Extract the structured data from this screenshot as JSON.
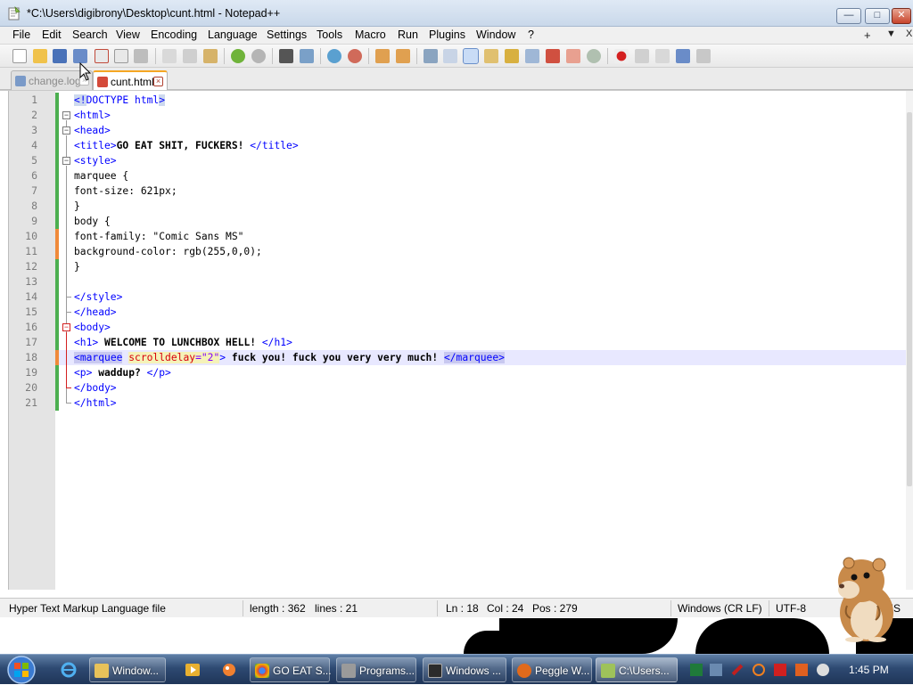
{
  "window": {
    "title": "*C:\\Users\\digibrony\\Desktop\\cunt.html - Notepad++",
    "min_glyph": "—",
    "max_glyph": "□",
    "close_glyph": "✕"
  },
  "menu": {
    "items": [
      "File",
      "Edit",
      "Search",
      "View",
      "Encoding",
      "Language",
      "Settings",
      "Tools",
      "Macro",
      "Run",
      "Plugins",
      "Window",
      "?"
    ],
    "right_plus": "+",
    "right_down": "▼",
    "right_close": "X"
  },
  "toolbar": {
    "icons": [
      "new-file",
      "open-file",
      "save",
      "save-all",
      "close",
      "close-all",
      "print",
      "cut",
      "copy",
      "paste",
      "undo",
      "redo",
      "find",
      "replace",
      "zoom-in",
      "zoom-out",
      "sync-vertical",
      "sync-horizontal",
      "word-wrap",
      "show-all-chars",
      "indent-guide",
      "user-defined-language",
      "doc-map",
      "function-list",
      "folder-as-workspace",
      "monitor",
      "record-macro",
      "stop-recording",
      "playback-macro",
      "run-macro-multiple",
      "save-macro"
    ]
  },
  "tabs": [
    {
      "label": "change.log",
      "active": false
    },
    {
      "label": "cunt.html",
      "active": true
    }
  ],
  "editor": {
    "line_numbers": [
      "1",
      "2",
      "3",
      "4",
      "5",
      "6",
      "7",
      "8",
      "9",
      "10",
      "11",
      "12",
      "13",
      "14",
      "15",
      "16",
      "17",
      "18",
      "19",
      "20",
      "21"
    ],
    "current_line": 18,
    "lines": {
      "l1": {
        "open": "<!",
        "rest": "DOCTYPE html",
        "close": ">"
      },
      "l2": {
        "tag": "<html>"
      },
      "l3": {
        "tag": "<head>"
      },
      "l4": {
        "open": "<title>",
        "text": "GO EAT SHIT, FUCKERS! ",
        "close": "</title>"
      },
      "l5": {
        "tag": "<style>"
      },
      "l6": {
        "text": "marquee {"
      },
      "l7": {
        "text": "font-size: 621px;"
      },
      "l8": {
        "text": "}"
      },
      "l9": {
        "text": "body {"
      },
      "l10": {
        "text": "font-family: \"Comic Sans MS\""
      },
      "l11": {
        "text": "background-color: rgb(255,0,0);"
      },
      "l12": {
        "text": "}"
      },
      "l13": {
        "text": ""
      },
      "l14": {
        "tag": "</style>"
      },
      "l15": {
        "tag": "</head>"
      },
      "l16": {
        "tag": "<body>"
      },
      "l17": {
        "open": "<h1>",
        "text": " WELCOME TO LUNCHBOX HELL! ",
        "close": "</h1>"
      },
      "l18": {
        "open_lt": "<",
        "open_name": "marquee",
        "sp": " ",
        "attr": "scrolldelay",
        "eq": "=",
        "val": "\"2\"",
        "gt": ">",
        "text": " fuck you! fuck you very very much! ",
        "close": "</marquee>"
      },
      "l19": {
        "open": "<p>",
        "text": " waddup? ",
        "close": "</p>"
      },
      "l20": {
        "tag": "</body>"
      },
      "l21": {
        "tag": "</html>"
      }
    }
  },
  "status": {
    "file_type": "Hyper Text Markup Language file",
    "length": "length : 362",
    "lines": "lines : 21",
    "ln": "Ln : 18",
    "col": "Col : 24",
    "pos": "Pos : 279",
    "eol": "Windows (CR LF)",
    "encoding": "UTF-8",
    "mode": "INS"
  },
  "taskbar": {
    "items": [
      {
        "label": "Window...",
        "icon": "folder-icon",
        "color": "#e8c25a"
      },
      {
        "label": "GO EAT S...",
        "icon": "chrome-icon",
        "color": "#db4437"
      },
      {
        "label": "Programs...",
        "icon": "programs-icon",
        "color": "#8a8a8a"
      },
      {
        "label": "Windows ...",
        "icon": "terminal-icon",
        "color": "#2b2b2b"
      },
      {
        "label": "Peggle W...",
        "icon": "peggle-icon",
        "color": "#e06a1c"
      },
      {
        "label": "C:\\Users...",
        "icon": "notepadpp-icon",
        "color": "#9ec25a"
      }
    ],
    "clock": "1:45 PM"
  },
  "colors": {
    "tag": "#0000ff",
    "attribute": "#d8000c",
    "value": "#8000ff",
    "current_line": "#e8e8ff",
    "saved_change": "#4caf50",
    "unsaved_change": "#f08a3a"
  }
}
